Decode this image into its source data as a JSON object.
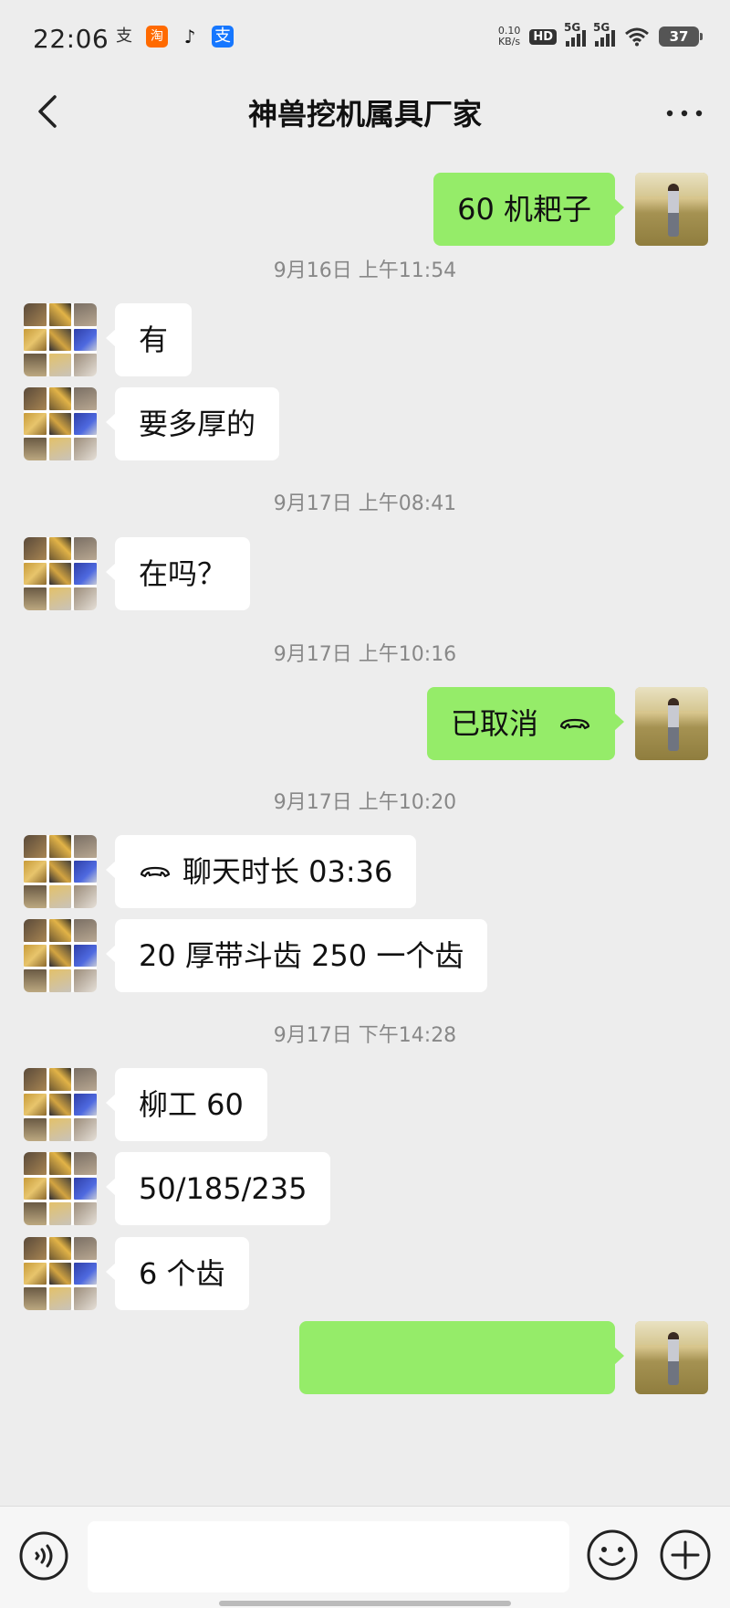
{
  "status_bar": {
    "time": "22:06",
    "app_icons": [
      "alipay-icon",
      "taobao-icon",
      "tiktok-icon",
      "alipay-icon"
    ],
    "net_speed_value": "0.10",
    "net_speed_unit": "KB/s",
    "hd_label": "HD",
    "sim1_label": "5G",
    "sim2_label": "5G",
    "battery_level": "37"
  },
  "nav": {
    "title": "神兽挖机属具厂家",
    "back_icon": "chevron-left-icon",
    "more_icon": "more-horizontal-icon"
  },
  "colors": {
    "background": "#ededed",
    "bubble_out": "#95ec69",
    "bubble_in": "#ffffff",
    "timestamp": "#888888"
  },
  "messages": [
    {
      "type": "msg",
      "dir": "out",
      "text": "60 机耙子"
    },
    {
      "type": "time",
      "text": "9月16日 上午11:54"
    },
    {
      "type": "msg",
      "dir": "in",
      "text": "有"
    },
    {
      "type": "msg",
      "dir": "in",
      "text": "要多厚的"
    },
    {
      "type": "time",
      "text": "9月17日 上午08:41"
    },
    {
      "type": "msg",
      "dir": "in",
      "text": "在吗？"
    },
    {
      "type": "time",
      "text": "9月17日 上午10:16"
    },
    {
      "type": "msg",
      "dir": "out",
      "text": "已取消",
      "icon": "phone-hangup-icon"
    },
    {
      "type": "time",
      "text": "9月17日 上午10:20"
    },
    {
      "type": "msg",
      "dir": "in",
      "text": "聊天时长 03:36",
      "icon": "phone-hangup-icon"
    },
    {
      "type": "msg",
      "dir": "in",
      "text": "20 厚带斗齿 250 一个齿"
    },
    {
      "type": "time",
      "text": "9月17日 下午14:28"
    },
    {
      "type": "msg",
      "dir": "in",
      "text": "柳工 60"
    },
    {
      "type": "msg",
      "dir": "in",
      "text": "50/185/235"
    },
    {
      "type": "msg",
      "dir": "in",
      "text": "6 个齿"
    },
    {
      "type": "msg",
      "dir": "out",
      "text": ""
    }
  ],
  "input_bar": {
    "voice_icon": "voice-icon",
    "input_value": "",
    "emoji_icon": "emoji-icon",
    "plus_icon": "plus-circle-icon"
  }
}
